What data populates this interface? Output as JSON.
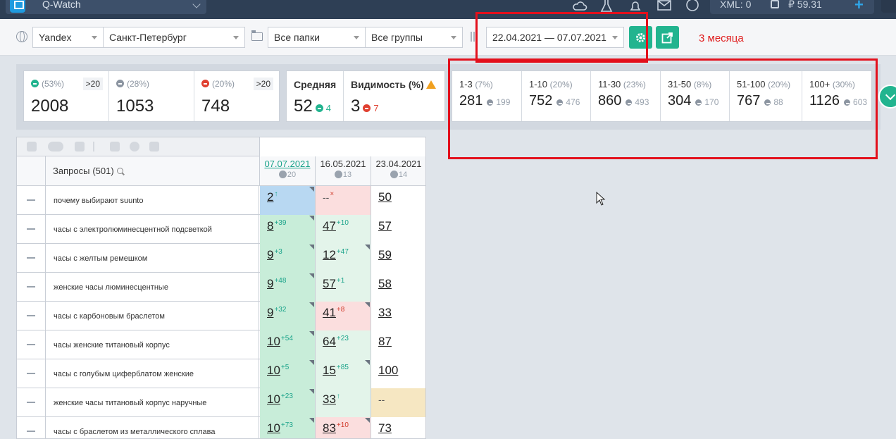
{
  "topbar": {
    "app_name": "Q-Watch",
    "xml_label": "XML: 0",
    "balance": "₽ 59.31",
    "add": "+"
  },
  "filters": {
    "engine": "Yandex",
    "region": "Санкт-Петербург",
    "folders": "Все папки",
    "groups": "Все группы",
    "date_range": "22.04.2021 — 07.07.2021",
    "note": "3 месяца"
  },
  "stats": {
    "up": {
      "pct": "(53%)",
      "value": "2008",
      "badge": ">20"
    },
    "same": {
      "pct": "(28%)",
      "value": "1053"
    },
    "down": {
      "pct": "(20%)",
      "value": "748",
      "badge": ">20"
    },
    "average": {
      "label": "Средняя",
      "value": "52",
      "delta": "4"
    },
    "visibility": {
      "label": "Видимость (%)",
      "value": "3",
      "delta": "7"
    }
  },
  "ranges": [
    {
      "label": "1-3",
      "pct": "(7%)",
      "value": "281",
      "prev": "199"
    },
    {
      "label": "1-10",
      "pct": "(20%)",
      "value": "752",
      "prev": "476"
    },
    {
      "label": "11-30",
      "pct": "(23%)",
      "value": "860",
      "prev": "493"
    },
    {
      "label": "31-50",
      "pct": "(8%)",
      "value": "304",
      "prev": "170"
    },
    {
      "label": "51-100",
      "pct": "(20%)",
      "value": "767",
      "prev": "88"
    },
    {
      "label": "100+",
      "pct": "(30%)",
      "value": "1126",
      "prev": "603"
    }
  ],
  "table": {
    "queries_label": "Запросы",
    "queries_count": "(501)",
    "dates": [
      {
        "date": "07.07.2021",
        "sub": "20"
      },
      {
        "date": "16.05.2021",
        "sub": "13"
      },
      {
        "date": "23.04.2021",
        "sub": "14"
      }
    ],
    "rows": [
      {
        "query": "почему выбирают suunto",
        "cells": [
          {
            "v": "2",
            "d": "↑",
            "c": "g",
            "bg": "bg-blue",
            "corner": true
          },
          {
            "v": "--",
            "d": "×",
            "c": "r",
            "bg": "bg-pink",
            "dash": true
          },
          {
            "v": "50",
            "d": "",
            "bg": "bg-white"
          }
        ]
      },
      {
        "query": "часы с электролюминесцентной подсветкой",
        "cells": [
          {
            "v": "8",
            "d": "+39",
            "c": "g",
            "bg": "bg-green",
            "corner": true
          },
          {
            "v": "47",
            "d": "+10",
            "c": "g",
            "bg": "bg-lgreen"
          },
          {
            "v": "57",
            "d": "",
            "bg": "bg-white"
          }
        ]
      },
      {
        "query": "часы с желтым ремешком",
        "cells": [
          {
            "v": "9",
            "d": "+3",
            "c": "g",
            "bg": "bg-green",
            "corner": true
          },
          {
            "v": "12",
            "d": "+47",
            "c": "g",
            "bg": "bg-lgreen",
            "corner": true
          },
          {
            "v": "59",
            "d": "",
            "bg": "bg-white"
          }
        ]
      },
      {
        "query": "женские часы люминесцентные",
        "cells": [
          {
            "v": "9",
            "d": "+48",
            "c": "g",
            "bg": "bg-green",
            "corner": true
          },
          {
            "v": "57",
            "d": "+1",
            "c": "g",
            "bg": "bg-lgreen"
          },
          {
            "v": "58",
            "d": "",
            "bg": "bg-white"
          }
        ]
      },
      {
        "query": "часы с карбоновым браслетом",
        "cells": [
          {
            "v": "9",
            "d": "+32",
            "c": "g",
            "bg": "bg-green",
            "corner": true
          },
          {
            "v": "41",
            "d": "+8",
            "c": "r",
            "bg": "bg-pink",
            "corner": true
          },
          {
            "v": "33",
            "d": "",
            "bg": "bg-white"
          }
        ]
      },
      {
        "query": "часы женские титановый корпус",
        "cells": [
          {
            "v": "10",
            "d": "+54",
            "c": "g",
            "bg": "bg-green",
            "corner": true
          },
          {
            "v": "64",
            "d": "+23",
            "c": "g",
            "bg": "bg-lgreen"
          },
          {
            "v": "87",
            "d": "",
            "bg": "bg-white"
          }
        ]
      },
      {
        "query": "часы с голубым циферблатом женские",
        "cells": [
          {
            "v": "10",
            "d": "+5",
            "c": "g",
            "bg": "bg-green",
            "corner": true
          },
          {
            "v": "15",
            "d": "+85",
            "c": "g",
            "bg": "bg-lgreen",
            "corner": true
          },
          {
            "v": "100",
            "d": "",
            "bg": "bg-white"
          }
        ]
      },
      {
        "query": "женские часы титановый корпус наручные",
        "cells": [
          {
            "v": "10",
            "d": "+23",
            "c": "g",
            "bg": "bg-green",
            "corner": true
          },
          {
            "v": "33",
            "d": "↑",
            "c": "g",
            "bg": "bg-lgreen"
          },
          {
            "v": "--",
            "d": "",
            "bg": "bg-tan",
            "dash": true
          }
        ]
      },
      {
        "query": "часы с браслетом из металлического сплава",
        "cells": [
          {
            "v": "10",
            "d": "+73",
            "c": "g",
            "bg": "bg-green",
            "corner": true
          },
          {
            "v": "83",
            "d": "+10",
            "c": "r",
            "bg": "bg-pink",
            "corner": true
          },
          {
            "v": "73",
            "d": "",
            "bg": "bg-white"
          }
        ]
      }
    ]
  }
}
